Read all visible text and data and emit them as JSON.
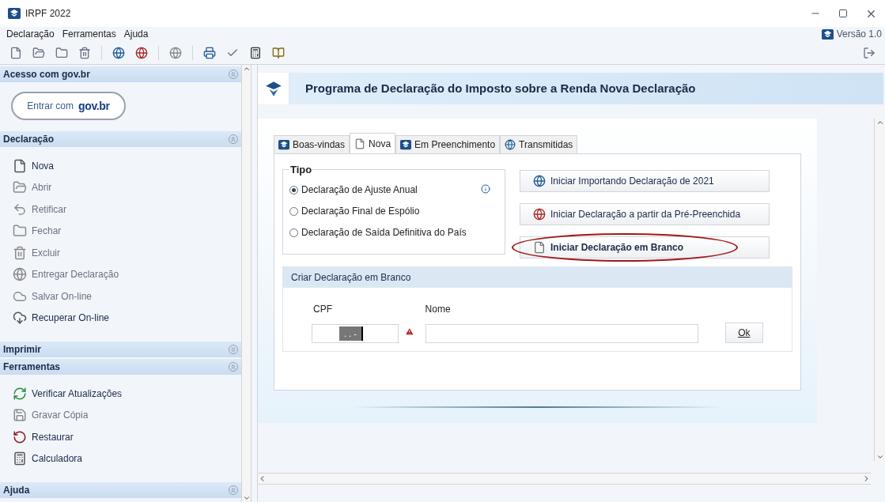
{
  "window": {
    "title": "IRPF 2022",
    "version": "Versão 1.0"
  },
  "menu": [
    "Declaração",
    "Ferramentas",
    "Ajuda"
  ],
  "sidebar": [
    {
      "kind": "login",
      "title": "Acesso com gov.br",
      "expanded": true,
      "button": "Entrar com",
      "brand": "gov.br"
    },
    {
      "kind": "list",
      "title": "Declaração",
      "expanded": true,
      "items": [
        {
          "label": "Nova",
          "kind": "file",
          "disabled": false
        },
        {
          "label": "Abrir",
          "kind": "open",
          "disabled": true
        },
        {
          "label": "Retificar",
          "kind": "back",
          "disabled": true
        },
        {
          "label": "Fechar",
          "kind": "folder",
          "disabled": true
        },
        {
          "label": "Excluir",
          "kind": "trash",
          "disabled": true
        },
        {
          "label": "Entregar Declaração",
          "kind": "globe",
          "disabled": true
        },
        {
          "label": "Salvar On-line",
          "kind": "cloud",
          "disabled": true
        },
        {
          "label": "Recuperar On-line",
          "kind": "download",
          "disabled": false
        }
      ]
    },
    {
      "kind": "list",
      "title": "Imprimir",
      "expanded": false
    },
    {
      "kind": "list",
      "title": "Ferramentas",
      "expanded": true,
      "items": [
        {
          "label": "Verificar Atualizações",
          "kind": "refresh",
          "disabled": false
        },
        {
          "label": "Gravar Cópia",
          "kind": "save",
          "disabled": true
        },
        {
          "label": "Restaurar",
          "kind": "restore",
          "disabled": false
        },
        {
          "label": "Calculadora",
          "kind": "calc",
          "disabled": false
        }
      ]
    },
    {
      "kind": "list",
      "title": "Ajuda",
      "expanded": true
    }
  ],
  "header": {
    "title": "Programa de Declaração do Imposto sobre a Renda Nova Declaração"
  },
  "tabs": [
    {
      "label": "Boas-vindas",
      "selected": false,
      "kind": "logo"
    },
    {
      "label": "Nova",
      "selected": true,
      "kind": "file"
    },
    {
      "label": "Em Preenchimento",
      "selected": false,
      "kind": "logo"
    },
    {
      "label": "Transmitidas",
      "selected": false,
      "kind": "globe"
    }
  ],
  "tipo": {
    "legend": "Tipo",
    "options": [
      {
        "label": "Declaração de Ajuste Anual",
        "selected": true
      },
      {
        "label": "Declaração Final de Espólio",
        "selected": false
      },
      {
        "label": "Declaração de Saída Definitiva do País",
        "selected": false
      }
    ]
  },
  "actions": [
    {
      "label": "Iniciar Importando Declaração de 2021",
      "kind": "globe",
      "highlighted": false
    },
    {
      "label": "Iniciar Declaração a partir da Pré-Preenchida",
      "kind": "globedoc",
      "highlighted": false
    },
    {
      "label": "Iniciar Declaração em Branco",
      "kind": "file",
      "highlighted": true
    }
  ],
  "blank_form": {
    "title": "Criar Declaração em Branco",
    "cpf": {
      "label": "CPF",
      "value": ". . -",
      "warning": true
    },
    "nome": {
      "label": "Nome"
    },
    "ok": "Ok"
  }
}
